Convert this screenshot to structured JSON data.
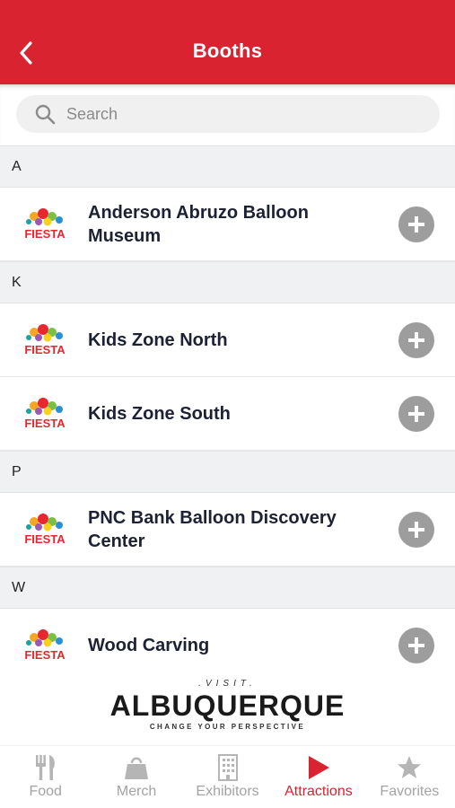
{
  "header": {
    "title": "Booths"
  },
  "search": {
    "placeholder": "Search"
  },
  "sections": [
    {
      "letter": "A",
      "items": [
        {
          "label": "Anderson Abruzo Balloon Museum",
          "logo": "FIESTA"
        }
      ]
    },
    {
      "letter": "K",
      "items": [
        {
          "label": "Kids Zone North",
          "logo": "FIESTA"
        },
        {
          "label": "Kids Zone South",
          "logo": "FIESTA"
        }
      ]
    },
    {
      "letter": "P",
      "items": [
        {
          "label": "PNC Bank Balloon Discovery Center",
          "logo": "FIESTA"
        }
      ]
    },
    {
      "letter": "W",
      "items": [
        {
          "label": "Wood Carving",
          "logo": "FIESTA"
        }
      ]
    }
  ],
  "sponsor": {
    "visit": ".VISIT.",
    "city": "ALBUQUERQUE",
    "tagline": "CHANGE YOUR PERSPECTIVE"
  },
  "tabs": [
    {
      "label": "Food",
      "icon": "fork-knife-icon"
    },
    {
      "label": "Merch",
      "icon": "shopping-bag-icon"
    },
    {
      "label": "Exhibitors",
      "icon": "building-icon"
    },
    {
      "label": "Attractions",
      "icon": "play-icon",
      "active": true
    },
    {
      "label": "Favorites",
      "icon": "star-icon"
    }
  ],
  "colors": {
    "brand_red": "#d92331",
    "tab_inactive": "#a3a3a3",
    "add_button": "#9d9d9d"
  }
}
